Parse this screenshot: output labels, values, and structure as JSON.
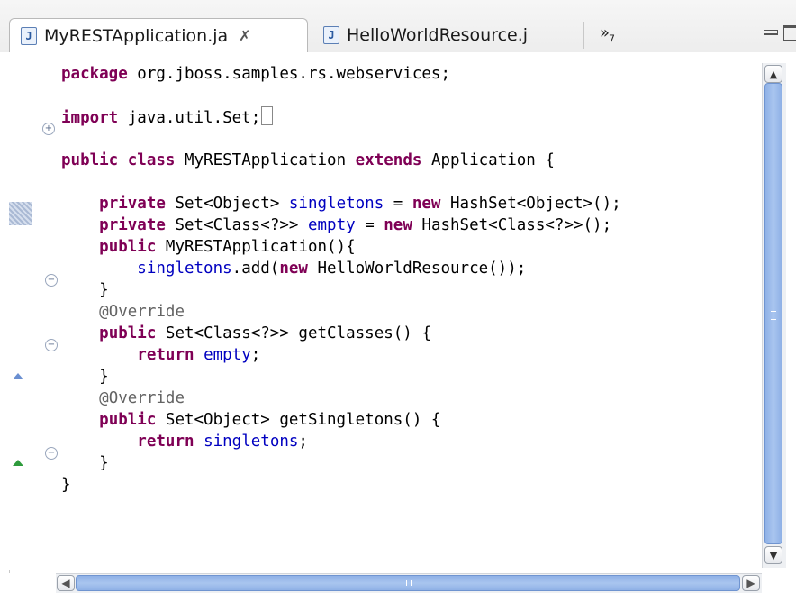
{
  "tabs": [
    {
      "label": "MyRESTApplication.ja",
      "icon": "java-file-icon",
      "active": true,
      "close_glyph": "✗"
    },
    {
      "label": "HelloWorldResource.j",
      "icon": "java-file-icon",
      "active": false
    }
  ],
  "tab_overflow": {
    "glyph": "»",
    "count": "7"
  },
  "window_controls": [
    "minimize-icon",
    "maximize-icon"
  ],
  "editor": {
    "file_type": "java",
    "lines": [
      [
        {
          "t": "package",
          "c": "kw"
        },
        {
          "t": " org.jboss.samples.rs.webservices;"
        }
      ],
      [],
      [
        {
          "t": "import",
          "c": "kw"
        },
        {
          "t": " java.util.Set;"
        }
      ],
      [],
      [
        {
          "t": "public",
          "c": "kw"
        },
        {
          "t": " "
        },
        {
          "t": "class",
          "c": "kw"
        },
        {
          "t": " MyRESTApplication "
        },
        {
          "t": "extends",
          "c": "kw"
        },
        {
          "t": " Application {"
        }
      ],
      [],
      [
        {
          "t": "    "
        },
        {
          "t": "private",
          "c": "kw"
        },
        {
          "t": " Set<Object> "
        },
        {
          "t": "singletons",
          "c": "fld"
        },
        {
          "t": " = "
        },
        {
          "t": "new",
          "c": "kw"
        },
        {
          "t": " HashSet<Object>();"
        }
      ],
      [
        {
          "t": "    "
        },
        {
          "t": "private",
          "c": "kw"
        },
        {
          "t": " Set<Class<?>> "
        },
        {
          "t": "empty",
          "c": "fld"
        },
        {
          "t": " = "
        },
        {
          "t": "new",
          "c": "kw"
        },
        {
          "t": " HashSet<Class<?>>();"
        }
      ],
      [
        {
          "t": "    "
        },
        {
          "t": "public",
          "c": "kw"
        },
        {
          "t": " MyRESTApplication(){"
        }
      ],
      [
        {
          "t": "        "
        },
        {
          "t": "singletons",
          "c": "fld"
        },
        {
          "t": ".add("
        },
        {
          "t": "new",
          "c": "kw"
        },
        {
          "t": " HelloWorldResource());"
        }
      ],
      [
        {
          "t": "    }"
        }
      ],
      [
        {
          "t": "    "
        },
        {
          "t": "@Override",
          "c": "ann"
        }
      ],
      [
        {
          "t": "    "
        },
        {
          "t": "public",
          "c": "kw"
        },
        {
          "t": " Set<Class<?>> getClasses() {"
        }
      ],
      [
        {
          "t": "        "
        },
        {
          "t": "return",
          "c": "kw"
        },
        {
          "t": " "
        },
        {
          "t": "empty",
          "c": "fld"
        },
        {
          "t": ";"
        }
      ],
      [
        {
          "t": "    }"
        }
      ],
      [
        {
          "t": "    "
        },
        {
          "t": "@Override",
          "c": "ann"
        }
      ],
      [
        {
          "t": "    "
        },
        {
          "t": "public",
          "c": "kw"
        },
        {
          "t": " Set<Object> getSingletons() {"
        }
      ],
      [
        {
          "t": "        "
        },
        {
          "t": "return",
          "c": "kw"
        },
        {
          "t": " "
        },
        {
          "t": "singletons",
          "c": "fld"
        },
        {
          "t": ";"
        }
      ],
      [
        {
          "t": "    }"
        }
      ],
      [
        {
          "t": "}"
        }
      ]
    ],
    "current_line": 7,
    "collapsed_import_line": 3,
    "fold_markers": [
      "expand-import",
      "collapse-constructor",
      "collapse-getClasses",
      "collapse-getSingletons"
    ],
    "gutter_markers": [
      "current-line-marker",
      "override-indicator",
      "implements-indicator"
    ]
  },
  "colors": {
    "keyword": "#7f0055",
    "field": "#0000c0",
    "annotation": "#646464",
    "current_line": "#e8f2fe",
    "scroll_thumb": "#8fb1e6"
  }
}
